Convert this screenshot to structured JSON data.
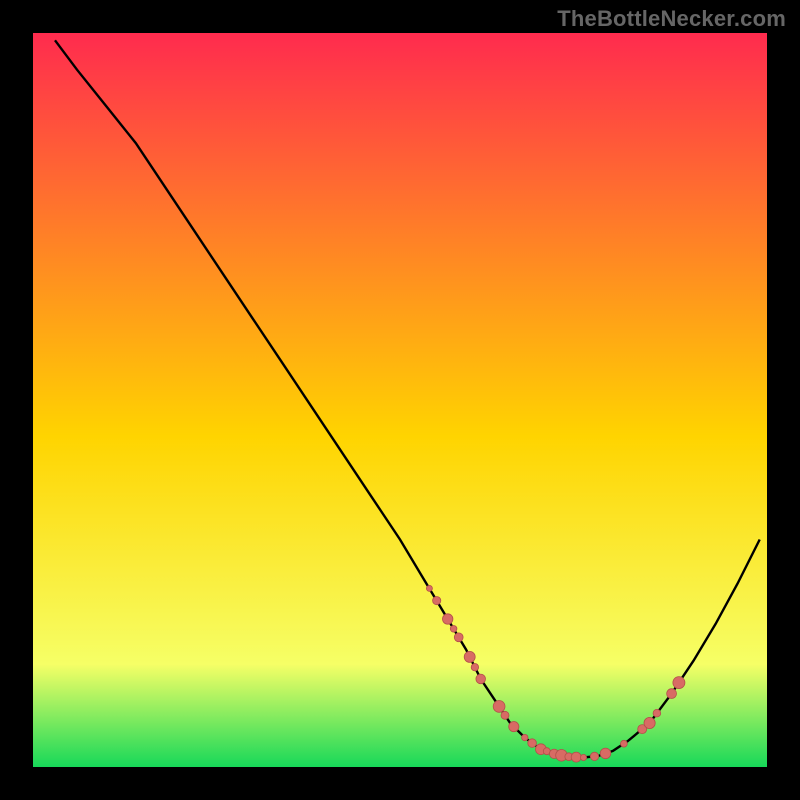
{
  "watermark": "TheBottleNecker.com",
  "colors": {
    "gradient_top": "#ff2b4e",
    "gradient_mid": "#ffd400",
    "gradient_low": "#f6ff66",
    "gradient_bottom": "#17d859",
    "curve": "#000000",
    "marker_fill": "#d86b64",
    "marker_stroke": "#b44f4a",
    "frame_bg": "#000000"
  },
  "chart_data": {
    "type": "line",
    "title": "",
    "xlabel": "",
    "ylabel": "",
    "xlim": [
      0,
      100
    ],
    "ylim": [
      0,
      100
    ],
    "curve": {
      "x": [
        3,
        6,
        10,
        14,
        18,
        22,
        26,
        30,
        34,
        38,
        42,
        46,
        50,
        53,
        56,
        59,
        61,
        63,
        65,
        67,
        69,
        71,
        73,
        75,
        77,
        79,
        81,
        84,
        87,
        90,
        93,
        96,
        99
      ],
      "y": [
        99,
        95,
        90,
        85,
        79,
        73,
        67,
        61,
        55,
        49,
        43,
        37,
        31,
        26,
        21,
        16,
        12,
        9,
        6,
        4,
        2.5,
        1.8,
        1.4,
        1.3,
        1.5,
        2.2,
        3.5,
        6,
        10,
        14.5,
        19.5,
        25,
        31
      ]
    },
    "markers_on_curve_x": [
      54,
      55,
      56.5,
      57.3,
      58,
      59.5,
      60.2,
      61,
      63.5,
      64.3,
      65.5,
      67,
      68,
      69.2,
      70,
      71,
      72,
      73,
      74,
      75,
      76.5,
      78,
      80.5,
      83,
      84,
      85,
      87,
      88
    ],
    "marker_radius_range": [
      3,
      6
    ]
  }
}
